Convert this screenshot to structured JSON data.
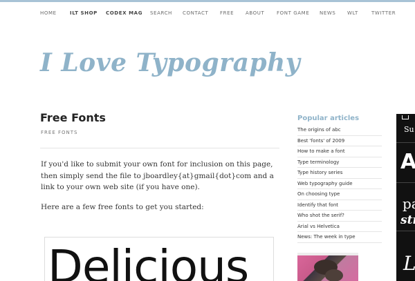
{
  "nav": {
    "items": [
      "HOME",
      "ILT SHOP",
      "CODEX MAG",
      "SEARCH",
      "CONTACT",
      "FREE",
      "ABOUT",
      "FONT GAME",
      "NEWS",
      "WLT",
      "TWITTER"
    ]
  },
  "site": {
    "logo": "I Love Typography"
  },
  "main": {
    "title": "Free Fonts",
    "breadcrumb": "FREE FONTS",
    "intro": "If you'd like to submit your own font for inclusion on this page, then simply send the file to jboardley{at}gmail{dot}com and a link to your own web site (if you have one).",
    "intro2": "Here are a few free fonts to get you started:",
    "font_preview": "Delicious"
  },
  "sidebar": {
    "title": "Popular articles",
    "items": [
      "The origins of abc",
      "Best 'fonts' of 2009",
      "How to make a font",
      "Type terminology",
      "Type history series",
      "Web typography guide",
      "On choosing type",
      "Identify that font",
      "Who shot the serif?",
      "Arial vs Helvetica",
      "News: The week in type"
    ]
  },
  "rail": {
    "glyphs": [
      "Su",
      "A",
      "pa",
      "str",
      "L"
    ]
  },
  "colors": {
    "accent": "#8fb3c9",
    "topbar": "#a8c3d6",
    "rail": "#111111"
  }
}
